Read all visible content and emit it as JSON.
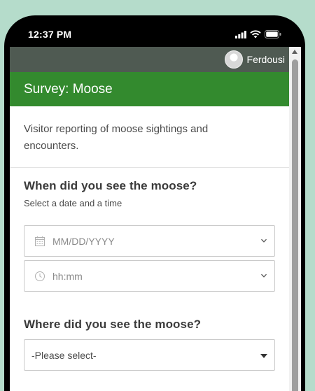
{
  "status_bar": {
    "time": "12:37 PM"
  },
  "top_bar": {
    "user_name": "Ferdousi"
  },
  "header": {
    "title": "Survey: Moose"
  },
  "description": "Visitor reporting of moose sightings and encounters.",
  "questions": [
    {
      "title": "When did you see the moose?",
      "hint": "Select a date and a time",
      "date_placeholder": "MM/DD/YYYY",
      "time_placeholder": "hh:mm"
    },
    {
      "title": "Where did you see the moose?",
      "select_value": "-Please select-"
    }
  ],
  "colors": {
    "background": "#b5dccb",
    "top_bar": "#4f5a52",
    "header": "#338a2e"
  },
  "icons": [
    "signal-icon",
    "wifi-icon",
    "battery-icon",
    "calendar-icon",
    "clock-icon",
    "chevron-down-icon",
    "caret-down-icon",
    "scroll-up-arrow-icon"
  ]
}
